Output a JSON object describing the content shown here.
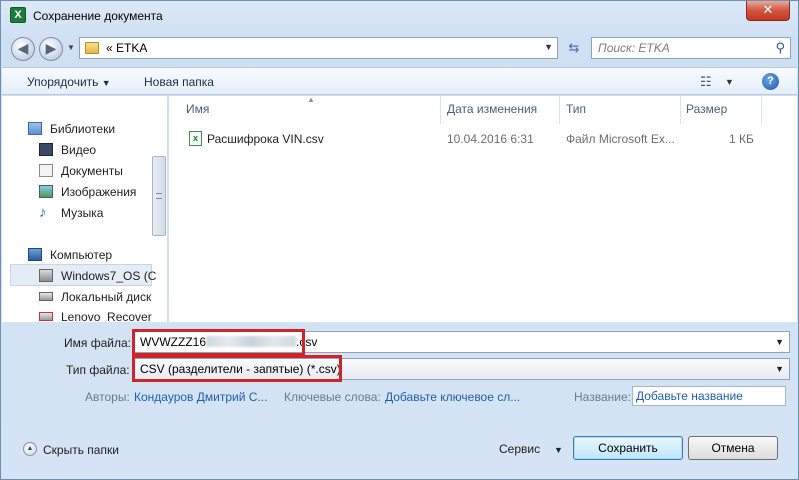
{
  "window": {
    "title": "Сохранение документа",
    "app_icon": "X",
    "close_label": "✕"
  },
  "address": {
    "path_prefix": "«",
    "path": "ETKA",
    "search_placeholder": "Поиск: ETKA"
  },
  "toolbar": {
    "organize": "Упорядочить",
    "new_folder": "Новая папка",
    "help": "?"
  },
  "nav": {
    "items": [
      {
        "label": "Библиотеки",
        "icon": "libraries-icon"
      },
      {
        "label": "Видео",
        "icon": "video-icon"
      },
      {
        "label": "Документы",
        "icon": "documents-icon"
      },
      {
        "label": "Изображения",
        "icon": "pictures-icon"
      },
      {
        "label": "Музыка",
        "icon": "music-icon"
      },
      {
        "label": "Компьютер",
        "icon": "computer-icon"
      },
      {
        "label": "Windows7_OS (C",
        "icon": "drive-icon"
      },
      {
        "label": "Локальный диск",
        "icon": "drive-icon"
      },
      {
        "label": "Lenovo_Recover",
        "icon": "drive-icon"
      }
    ]
  },
  "filelist": {
    "columns": [
      "Имя",
      "Дата изменения",
      "Тип",
      "Размер"
    ],
    "rows": [
      {
        "name": "Расшифрока VIN.csv",
        "date": "10.04.2016 6:31",
        "type": "Файл Microsoft Ex...",
        "size": "1 КБ"
      }
    ]
  },
  "form": {
    "filename_label": "Имя файла:",
    "filename_prefix": "WVWZZZ16",
    "filename_suffix": ".csv",
    "filetype_label": "Тип файла:",
    "filetype_value": "CSV (разделители - запятые) (*.csv)",
    "authors_label": "Авторы:",
    "authors_value": "Кондауров Дмитрий С...",
    "keywords_label": "Ключевые слова:",
    "keywords_value": "Добавьте ключевое сл...",
    "title_label": "Название:",
    "title_value": "Добавьте название"
  },
  "footer": {
    "hide_folders": "Скрыть папки",
    "service": "Сервис",
    "save": "Сохранить",
    "cancel": "Отмена"
  },
  "colors": {
    "highlight_box": "#d0242a",
    "link": "#1f5fa8"
  }
}
